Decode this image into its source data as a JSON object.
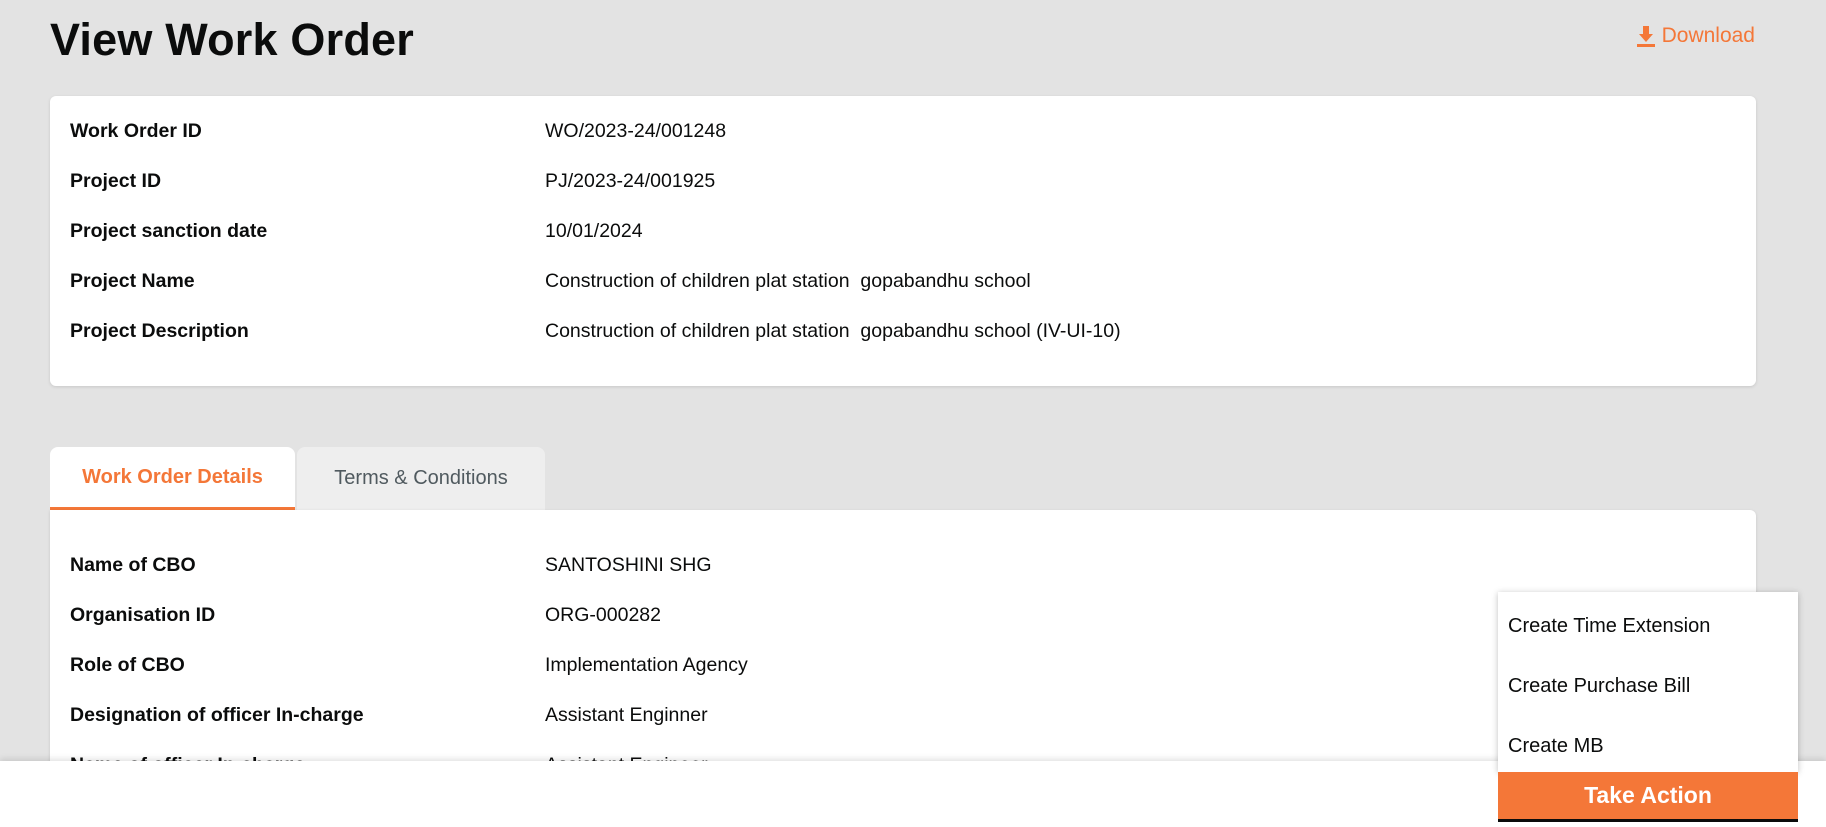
{
  "page": {
    "title": "View Work Order",
    "download_label": "Download"
  },
  "work_order_summary": [
    {
      "label": "Work Order ID",
      "value": "WO/2023-24/001248"
    },
    {
      "label": "Project ID",
      "value": "PJ/2023-24/001925"
    },
    {
      "label": "Project sanction date",
      "value": "10/01/2024"
    },
    {
      "label": "Project Name",
      "value": "Construction of children plat station  gopabandhu school"
    },
    {
      "label": "Project Description",
      "value": "Construction of children plat station  gopabandhu school (IV-UI-10)"
    }
  ],
  "tabs": [
    {
      "label": "Work Order Details",
      "active": true
    },
    {
      "label": "Terms & Conditions",
      "active": false
    }
  ],
  "work_order_details": [
    {
      "label": "Name of CBO",
      "value": "SANTOSHINI SHG"
    },
    {
      "label": "Organisation ID",
      "value": "ORG-000282"
    },
    {
      "label": "Role of CBO",
      "value": "Implementation Agency"
    },
    {
      "label": "Designation of officer In-charge",
      "value": "Assistant Enginner"
    },
    {
      "label": "Name of officer In-charge",
      "value": "Assistant Engineer"
    }
  ],
  "action_menu": {
    "items": [
      "Create Time Extension",
      "Create Purchase Bill",
      "Create MB"
    ],
    "button_label": "Take Action"
  },
  "colors": {
    "accent": "#f47738",
    "background": "#e3e3e3",
    "text": "#0b0c0c"
  }
}
